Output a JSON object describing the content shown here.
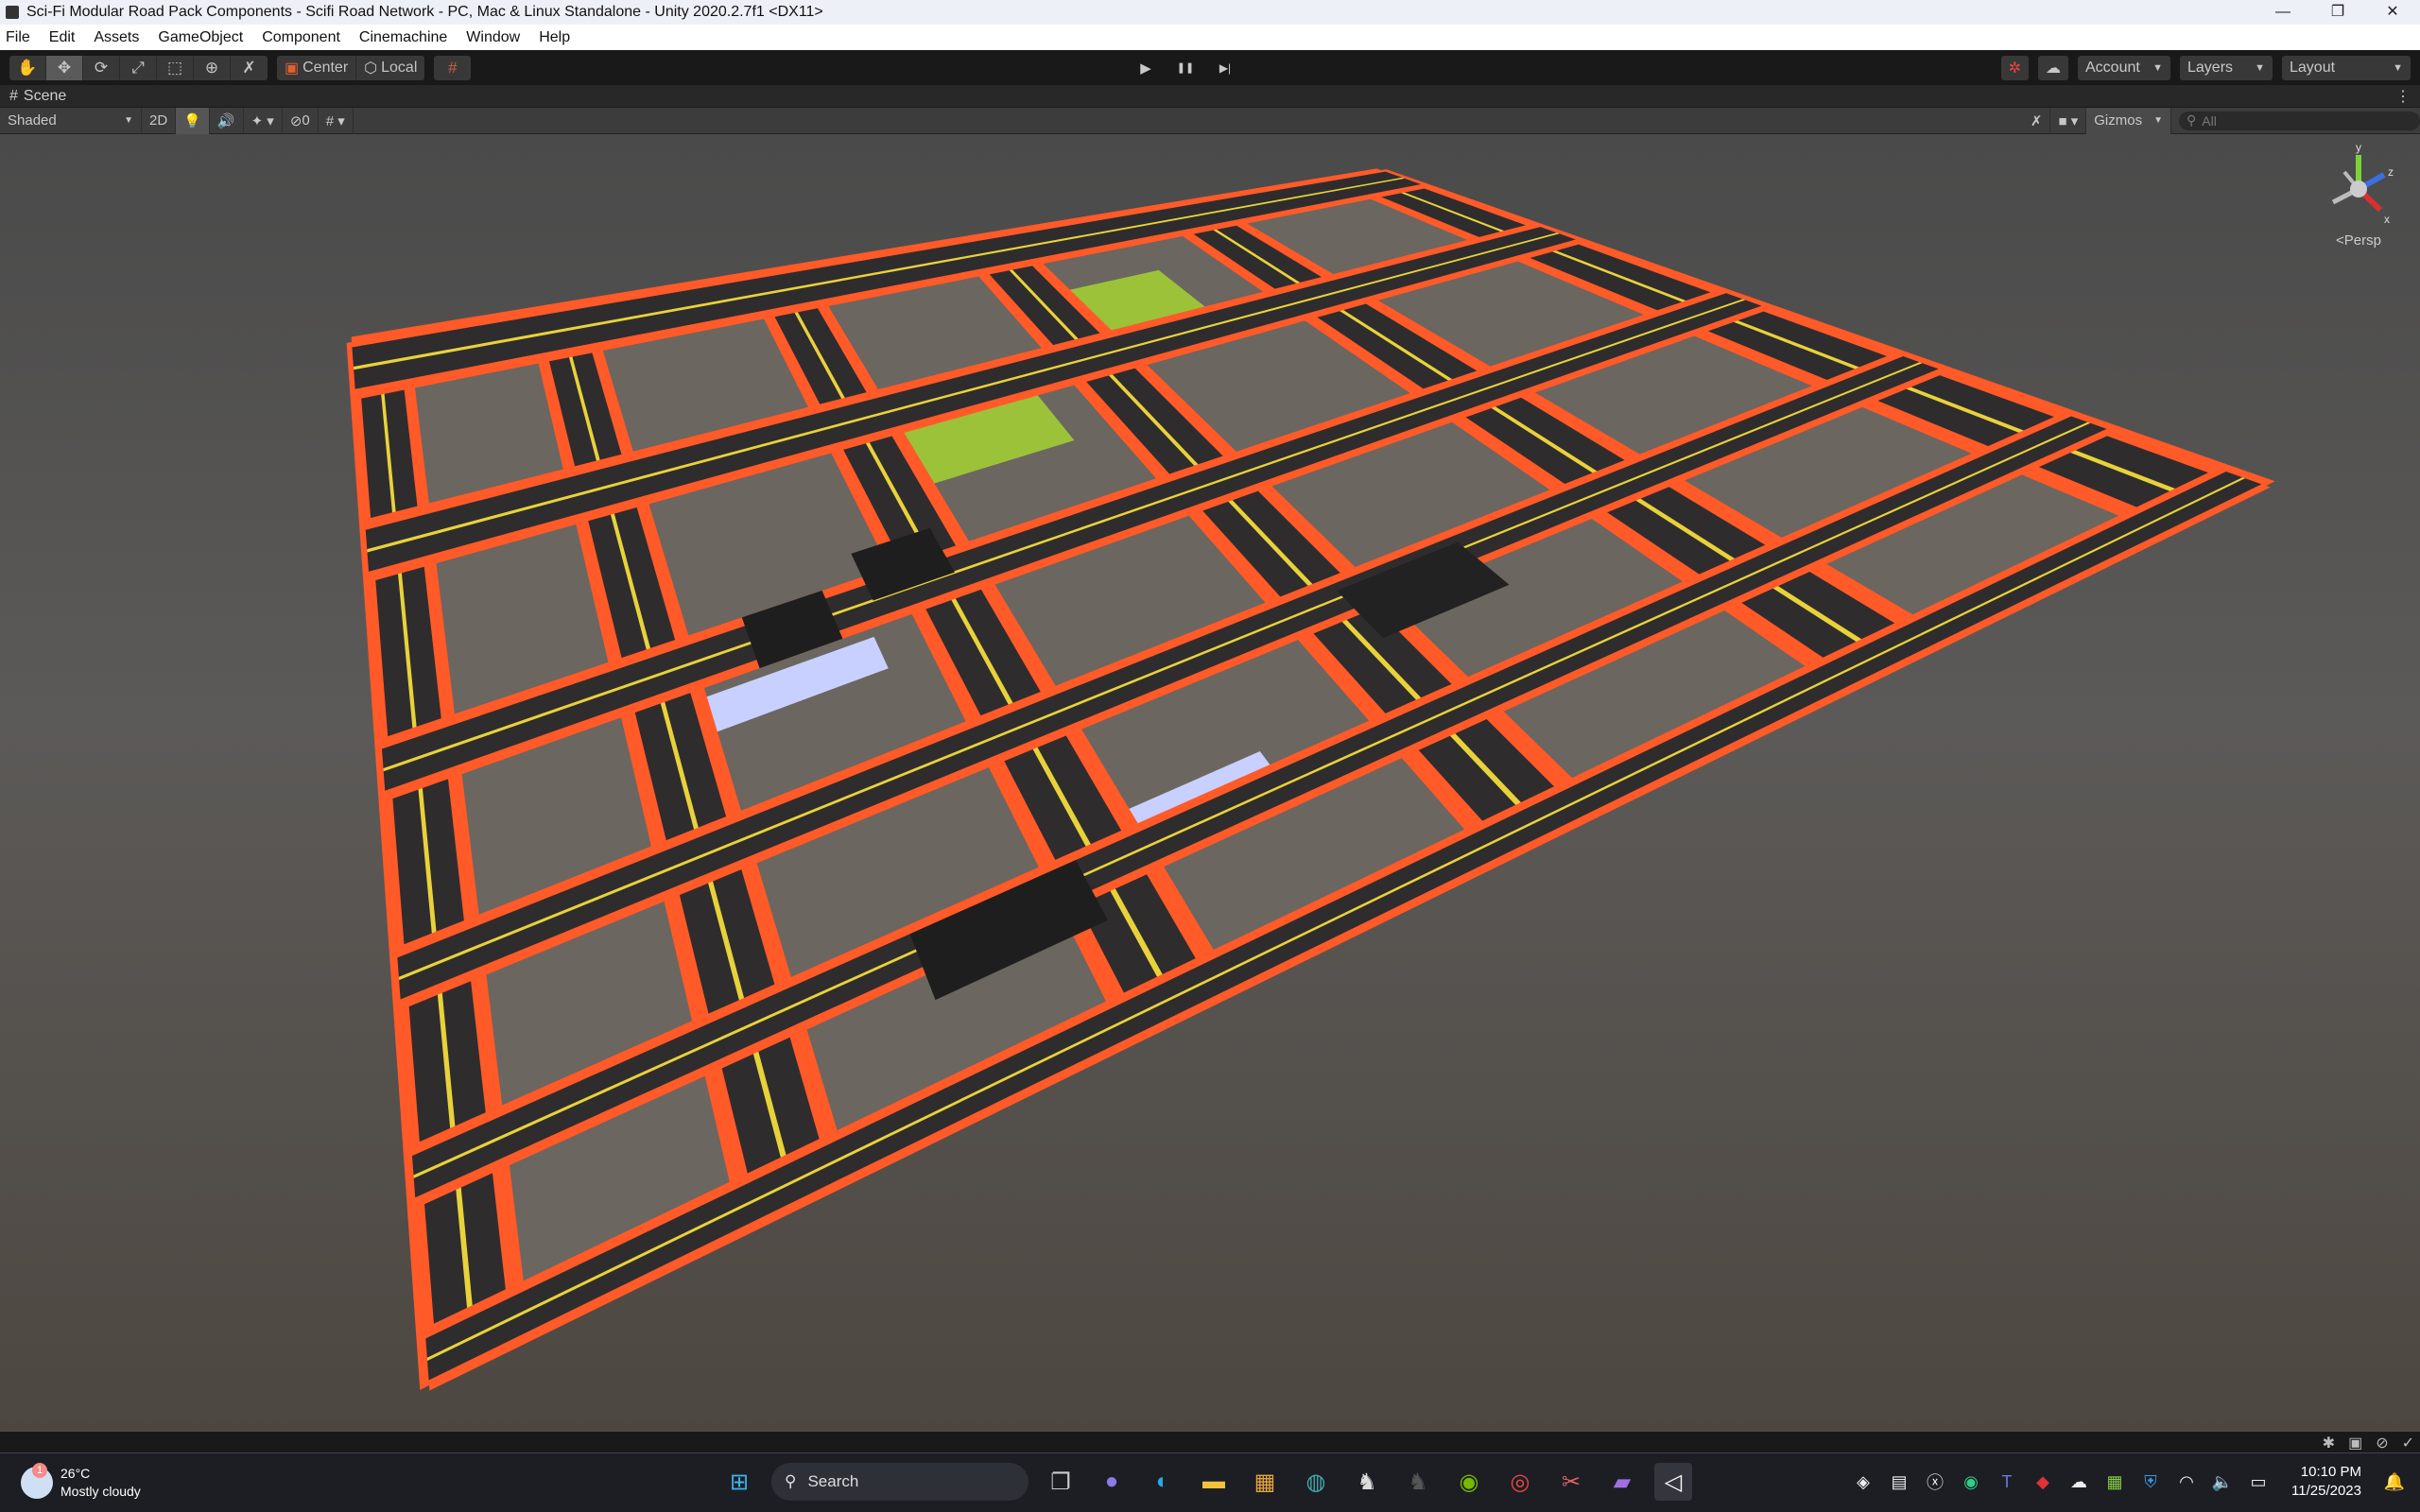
{
  "window": {
    "title": "Sci-Fi Modular Road Pack Components - Scifi Road Network - PC, Mac & Linux Standalone - Unity 2020.2.7f1 <DX11>",
    "controls": [
      "—",
      "❐",
      "✕"
    ]
  },
  "menu": [
    "File",
    "Edit",
    "Assets",
    "GameObject",
    "Component",
    "Cinemachine",
    "Window",
    "Help"
  ],
  "toolbar": {
    "tools": [
      "✋",
      "✥",
      "⟳",
      "⤢",
      "⬚",
      "⊕",
      "✗"
    ],
    "pivot": "Center",
    "space": "Local",
    "play": "▶",
    "pause": "❚❚",
    "step": "▶|",
    "account": "Account",
    "layers": "Layers",
    "layout": "Layout"
  },
  "scene": {
    "tab": "Scene",
    "shading": "Shaded",
    "mode2d": "2D",
    "hidden_count": "0",
    "gizmos": "Gizmos",
    "search_placeholder": "All",
    "projection": "<Persp",
    "axis": {
      "y": "y",
      "x": "x",
      "z": "z"
    }
  },
  "colors": {
    "road": "#2f2c2e",
    "curb": "#ff5a28",
    "line": "#e8d23a",
    "ground": "#6b6660",
    "grass": "#9cc23a",
    "water": "#c8d0ff"
  },
  "taskbar": {
    "temp": "26°C",
    "weather": "Mostly cloudy",
    "weather_badge": "1",
    "search": "Search",
    "time": "10:10 PM",
    "date": "11/25/2023"
  }
}
